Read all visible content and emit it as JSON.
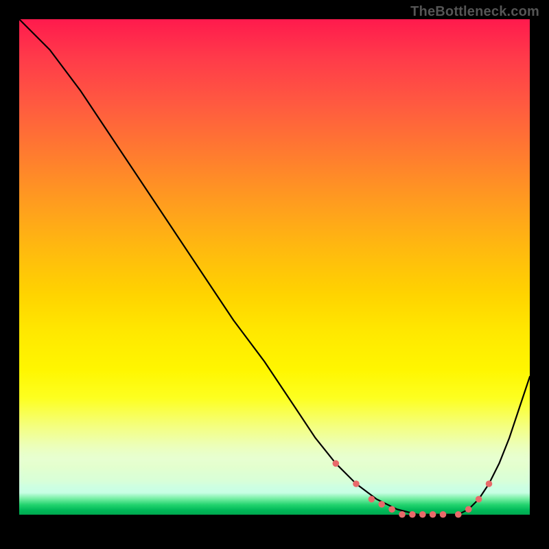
{
  "watermark": "TheBottleneck.com",
  "chart_data": {
    "type": "line",
    "title": "",
    "xlabel": "",
    "ylabel": "",
    "xlim": [
      0,
      100
    ],
    "ylim": [
      0,
      100
    ],
    "grid": false,
    "legend": false,
    "background": "gradient-red-to-green",
    "series": [
      {
        "name": "bottleneck-curve",
        "x": [
          0,
          6,
          12,
          18,
          24,
          30,
          36,
          42,
          48,
          54,
          58,
          62,
          66,
          70,
          74,
          78,
          82,
          84,
          86,
          88,
          90,
          92,
          94,
          96,
          98,
          100
        ],
        "y": [
          100,
          94,
          86,
          77,
          68,
          59,
          50,
          41,
          33,
          24,
          18,
          13,
          9,
          6,
          4,
          3,
          3,
          3,
          3,
          4,
          6,
          9,
          13,
          18,
          24,
          30
        ]
      }
    ],
    "markers": {
      "name": "valley-dots",
      "x": [
        62,
        66,
        69,
        71,
        73,
        75,
        77,
        79,
        81,
        83,
        86,
        88,
        90,
        92
      ],
      "y": [
        13,
        9,
        6,
        5,
        4,
        3,
        3,
        3,
        3,
        3,
        3,
        4,
        6,
        9
      ]
    }
  }
}
